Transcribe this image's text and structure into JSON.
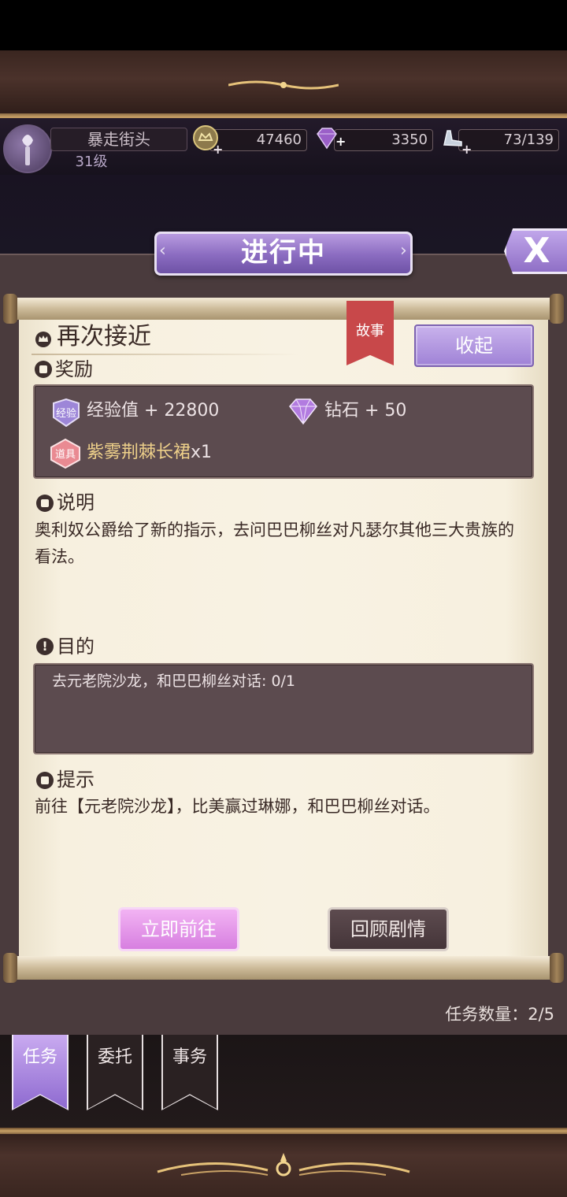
{
  "player": {
    "name": "暴走街头",
    "level": "31级"
  },
  "resources": {
    "gold": "47460",
    "diamonds": "3350",
    "stamina": "73/139",
    "plus": "+"
  },
  "dialog": {
    "title": "进行中",
    "close_label": "X"
  },
  "quest": {
    "title": "再次接近",
    "tag": "故事",
    "collapse_label": "收起",
    "rewards_label": "奖励",
    "rewards": {
      "exp_badge": "经验",
      "exp": "经验值 + 22800",
      "diamonds": "钻石 + 50",
      "item_badge": "道具",
      "item_name": "紫雾荆棘长裙",
      "item_qty": "x1"
    },
    "description_label": "说明",
    "description": "奥利奴公爵给了新的指示，去问巴巴柳丝对凡瑟尔其他三大贵族的看法。",
    "objective_label": "目的",
    "objective": "去元老院沙龙，和巴巴柳丝对话: 0/1",
    "hint_label": "提示",
    "hint": "前往【元老院沙龙】，比美赢过琳娜，和巴巴柳丝对话。",
    "go_label": "立即前往",
    "review_label": "回顾剧情"
  },
  "task_count": "任务数量：2/5",
  "tabs": [
    {
      "label": "任务",
      "active": true
    },
    {
      "label": "委托",
      "active": false
    },
    {
      "label": "事务",
      "active": false
    }
  ],
  "colors": {
    "accent_purple": "#9f82d6",
    "story_tag_red": "#c8484a",
    "item_gold": "#eed08a",
    "panel_dark": "#4a3b3d"
  },
  "icons": [
    "crown-icon",
    "gift-icon",
    "book-icon",
    "exclamation-icon",
    "note-icon",
    "gem-icon",
    "coin-icon",
    "shoe-icon",
    "torch-icon",
    "close-icon"
  ]
}
